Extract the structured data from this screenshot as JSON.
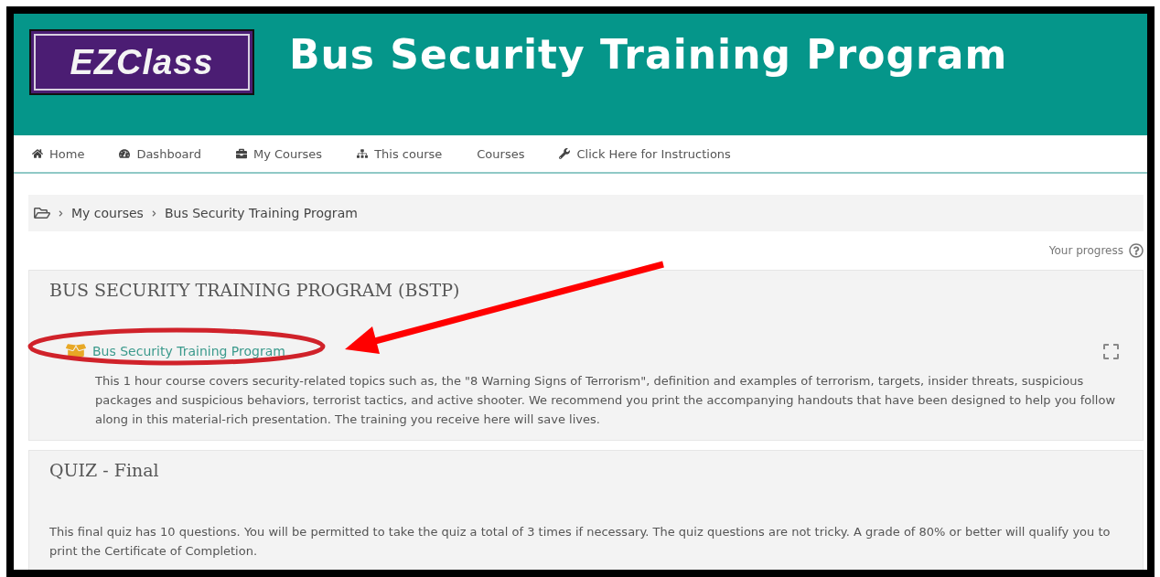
{
  "header": {
    "logo": "EZClass",
    "title": "Bus Security Training Program"
  },
  "nav": [
    {
      "label": "Home"
    },
    {
      "label": "Dashboard"
    },
    {
      "label": "My Courses"
    },
    {
      "label": "This course"
    },
    {
      "label": "Courses"
    },
    {
      "label": "Click Here for Instructions"
    }
  ],
  "breadcrumb": [
    "My courses",
    "Bus Security Training Program"
  ],
  "progress": {
    "label": "Your progress"
  },
  "sections": [
    {
      "title": "BUS SECURITY TRAINING PROGRAM (BSTP)",
      "activity": {
        "label": "Bus Security Training Program",
        "completed": false
      },
      "description": "This 1 hour course covers security-related topics such as, the \"8 Warning Signs of Terrorism\", definition and examples of terrorism, targets, insider threats, suspicious packages and suspicious behaviors, terrorist tactics, and active shooter.  We recommend you print the accompanying handouts that have been designed to help you follow along in this material-rich presentation.  The training you receive here will save lives."
    },
    {
      "title": "QUIZ - Final",
      "description": "This final quiz has 10 questions.  You will be permitted to take the quiz a total of 3 times if necessary.  The quiz questions are not tricky.  A grade of 80% or better will qualify you to print the Certificate of Completion."
    }
  ]
}
